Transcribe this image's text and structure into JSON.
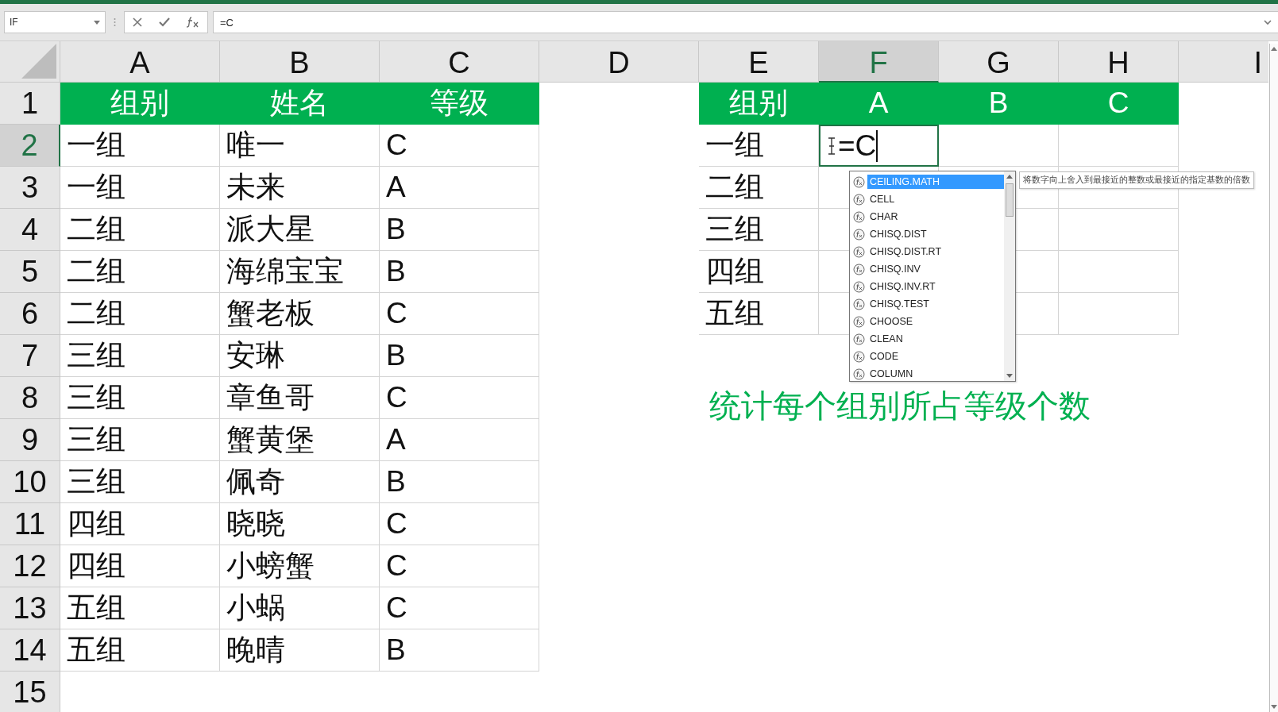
{
  "formula_bar": {
    "name_box": "IF",
    "formula": "=C"
  },
  "columns": [
    {
      "label": "A",
      "selected": false
    },
    {
      "label": "B",
      "selected": false
    },
    {
      "label": "C",
      "selected": false
    },
    {
      "label": "D",
      "selected": false
    },
    {
      "label": "E",
      "selected": false
    },
    {
      "label": "F",
      "selected": true
    },
    {
      "label": "G",
      "selected": false
    },
    {
      "label": "H",
      "selected": false
    },
    {
      "label": "I",
      "selected": false
    }
  ],
  "row_headers": [
    {
      "label": "1",
      "selected": false
    },
    {
      "label": "2",
      "selected": true
    },
    {
      "label": "3",
      "selected": false
    },
    {
      "label": "4",
      "selected": false
    },
    {
      "label": "5",
      "selected": false
    },
    {
      "label": "6",
      "selected": false
    },
    {
      "label": "7",
      "selected": false
    },
    {
      "label": "8",
      "selected": false
    },
    {
      "label": "9",
      "selected": false
    },
    {
      "label": "10",
      "selected": false
    },
    {
      "label": "11",
      "selected": false
    },
    {
      "label": "12",
      "selected": false
    },
    {
      "label": "13",
      "selected": false
    },
    {
      "label": "14",
      "selected": false
    },
    {
      "label": "15",
      "selected": false
    }
  ],
  "left_table": {
    "header": [
      "组别",
      "姓名",
      "等级"
    ],
    "rows": [
      [
        "一组",
        "唯一",
        "C"
      ],
      [
        "一组",
        "未来",
        "A"
      ],
      [
        "二组",
        "派大星",
        "B"
      ],
      [
        "二组",
        "海绵宝宝",
        "B"
      ],
      [
        "二组",
        "蟹老板",
        "C"
      ],
      [
        "三组",
        "安琳",
        "B"
      ],
      [
        "三组",
        "章鱼哥",
        "C"
      ],
      [
        "三组",
        "蟹黄堡",
        "A"
      ],
      [
        "三组",
        "佩奇",
        "B"
      ],
      [
        "四组",
        "晓晓",
        "C"
      ],
      [
        "四组",
        "小螃蟹",
        "C"
      ],
      [
        "五组",
        "小蜗",
        "C"
      ],
      [
        "五组",
        "晚晴",
        "B"
      ]
    ]
  },
  "right_table": {
    "header": [
      "组别",
      "A",
      "B",
      "C"
    ],
    "groups": [
      "一组",
      "二组",
      "三组",
      "四组",
      "五组"
    ],
    "active_cell": {
      "value": "=C"
    }
  },
  "autocomplete": {
    "items": [
      {
        "label": "CEILING.MATH",
        "selected": true
      },
      {
        "label": "CELL",
        "selected": false
      },
      {
        "label": "CHAR",
        "selected": false
      },
      {
        "label": "CHISQ.DIST",
        "selected": false
      },
      {
        "label": "CHISQ.DIST.RT",
        "selected": false
      },
      {
        "label": "CHISQ.INV",
        "selected": false
      },
      {
        "label": "CHISQ.INV.RT",
        "selected": false
      },
      {
        "label": "CHISQ.TEST",
        "selected": false
      },
      {
        "label": "CHOOSE",
        "selected": false
      },
      {
        "label": "CLEAN",
        "selected": false
      },
      {
        "label": "CODE",
        "selected": false
      },
      {
        "label": "COLUMN",
        "selected": false
      }
    ],
    "tooltip": "将数字向上舍入到最接近的整数或最接近的指定基数的倍数"
  },
  "note": "统计每个组别所占等级个数"
}
